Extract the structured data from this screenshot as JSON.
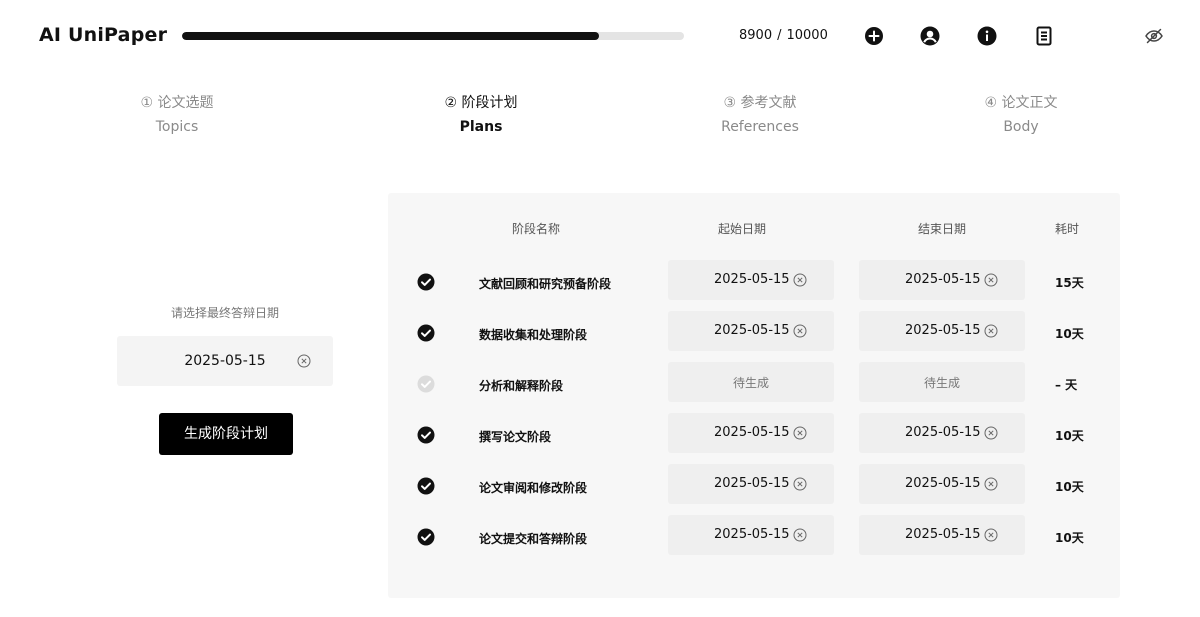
{
  "app": {
    "title": "AI UniPaper"
  },
  "header": {
    "progress_fraction": 0.83,
    "counter_current": "8900",
    "counter_sep": "/",
    "counter_total": "10000",
    "icons": [
      "add-circle-icon",
      "user-circle-icon",
      "info-icon",
      "document-icon",
      "eye-slash-icon"
    ]
  },
  "steps": [
    {
      "cn": "① 论文选题",
      "en": "Topics",
      "active": false
    },
    {
      "cn": "② 阶段计划",
      "en": "Plans",
      "active": true
    },
    {
      "cn": "③ 参考文献",
      "en": "References",
      "active": false
    },
    {
      "cn": "④ 论文正文",
      "en": "Body",
      "active": false
    }
  ],
  "left": {
    "label": "请选择最终答辩日期",
    "date_value": "2025-05-15",
    "generate_label": "生成阶段计划"
  },
  "table": {
    "headers": {
      "name": "阶段名称",
      "start": "起始日期",
      "end": "结束日期",
      "duration": "耗时"
    },
    "rows": [
      {
        "checked": true,
        "name": "文献回顾和研究预备阶段",
        "start": "2025-05-15",
        "end": "2025-05-15",
        "duration": "15天"
      },
      {
        "checked": true,
        "name": "数据收集和处理阶段",
        "start": "2025-05-15",
        "end": "2025-05-15",
        "duration": "10天"
      },
      {
        "checked": false,
        "name": "分析和解释阶段",
        "start": "待生成",
        "end": "待生成",
        "duration": "– 天"
      },
      {
        "checked": true,
        "name": "撰写论文阶段",
        "start": "2025-05-15",
        "end": "2025-05-15",
        "duration": "10天"
      },
      {
        "checked": true,
        "name": "论文审阅和修改阶段",
        "start": "2025-05-15",
        "end": "2025-05-15",
        "duration": "10天"
      },
      {
        "checked": true,
        "name": "论文提交和答辩阶段",
        "start": "2025-05-15",
        "end": "2025-05-15",
        "duration": "10天"
      }
    ]
  },
  "colors": {
    "accent": "#000000",
    "panel_bg": "#f7f7f7",
    "field_bg": "#efefef",
    "muted_check": "#dcdcdc"
  }
}
